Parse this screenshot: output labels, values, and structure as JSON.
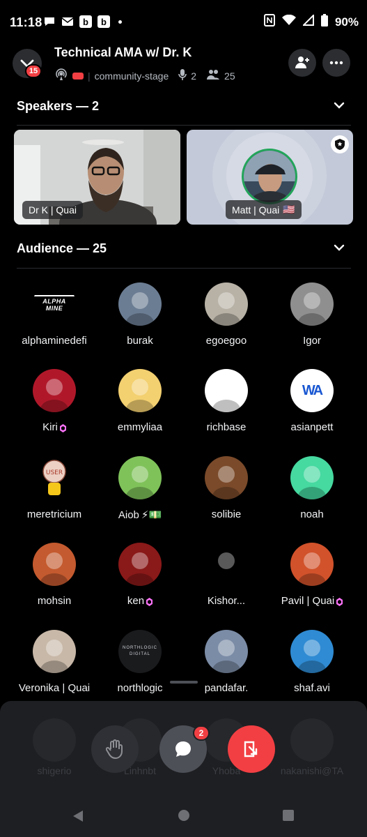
{
  "status_bar": {
    "time": "11:18",
    "battery": "90%",
    "app_badges": [
      "b",
      "b"
    ]
  },
  "header": {
    "title": "Technical AMA w/ Dr. K",
    "unread_count": "15",
    "channel": "community-stage",
    "speaker_count": "2",
    "listener_count": "25"
  },
  "speakers_section": {
    "label": "Speakers — 2",
    "speakers": [
      {
        "name": "Dr K | Quai",
        "flag": ""
      },
      {
        "name": "Matt | Quai",
        "flag": "🇺🇸"
      }
    ]
  },
  "audience_section": {
    "label": "Audience — 25",
    "members": [
      {
        "name": "alphaminedefi",
        "boost": false,
        "extra": "",
        "bg": "#000000"
      },
      {
        "name": "burak",
        "boost": false,
        "extra": "",
        "bg": "#6b7d93"
      },
      {
        "name": "egoegoo",
        "boost": false,
        "extra": "",
        "bg": "#b8b2a6"
      },
      {
        "name": "Igor",
        "boost": false,
        "extra": "",
        "bg": "#8f8f8f"
      },
      {
        "name": "Kiri",
        "boost": true,
        "extra": "",
        "bg": "#b0182a"
      },
      {
        "name": "emmyliaa",
        "boost": false,
        "extra": "",
        "bg": "#f3d070"
      },
      {
        "name": "richbase",
        "boost": false,
        "extra": "",
        "bg": "#ffffff"
      },
      {
        "name": "asianpett",
        "boost": false,
        "extra": "",
        "bg": "#ffffff"
      },
      {
        "name": "meretricium",
        "boost": false,
        "extra": "",
        "bg": "#000000"
      },
      {
        "name": "Aiob",
        "boost": false,
        "extra": "⚡💵",
        "bg": "#7fc25a"
      },
      {
        "name": "solibie",
        "boost": false,
        "extra": "",
        "bg": "#7a4a2a"
      },
      {
        "name": "noah",
        "boost": false,
        "extra": "",
        "bg": "#46d9a0"
      },
      {
        "name": "mohsin",
        "boost": false,
        "extra": "",
        "bg": "#c45a2f"
      },
      {
        "name": "ken",
        "boost": true,
        "extra": "",
        "bg": "#8a1919"
      },
      {
        "name": "Kishor...",
        "boost": false,
        "extra": "",
        "bg": "#000000"
      },
      {
        "name": "Pavil | Quai",
        "boost": true,
        "extra": "",
        "bg": "#d1522b"
      },
      {
        "name": "Veronika | Quai",
        "boost": false,
        "extra": "",
        "bg": "#c8b8a8"
      },
      {
        "name": "northlogic",
        "boost": false,
        "extra": "",
        "bg": "#1a1b1d"
      },
      {
        "name": "pandafar.",
        "boost": false,
        "extra": "",
        "bg": "#7b8ca6"
      },
      {
        "name": "shaf.avi",
        "boost": false,
        "extra": "",
        "bg": "#2f8bd3"
      }
    ],
    "logo_text": {
      "alphamine": "ALPHA MINE",
      "northlogic": "NORTHLOGIC DIGITAL",
      "user": "USER",
      "asianpett": "WA"
    }
  },
  "hidden_row": [
    "shigerio",
    "Linhnbt",
    "Yhoba",
    "nakanishi@TA"
  ],
  "controls": {
    "chat_badge": "2"
  },
  "colors": {
    "accent_red": "#f23f43",
    "boost_pink": "#ff73fa",
    "sheet_bg": "#1e1f22"
  }
}
